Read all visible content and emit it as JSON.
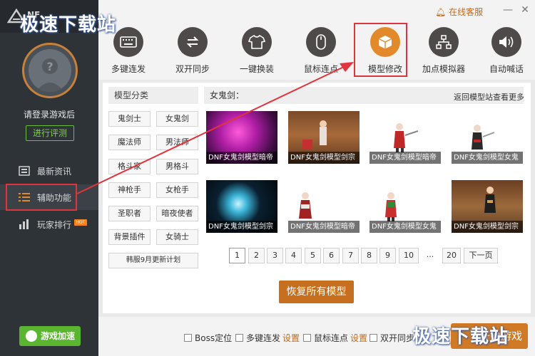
{
  "watermark_top": "极速下载站",
  "watermark_bottom": "极速下载站",
  "app": {
    "logo_text": "NF"
  },
  "topbar": {
    "service": "在线客服",
    "minimize": "—",
    "close": "✕"
  },
  "sidebar": {
    "login_text": "请登录游戏后",
    "eval_button": "进行评测",
    "nav": [
      {
        "label": "最新资讯"
      },
      {
        "label": "辅助功能"
      },
      {
        "label": "玩家排行"
      }
    ],
    "hot_badge": "HOT",
    "accel_button": "游戏加速"
  },
  "toolbar": [
    {
      "label": "多键连发",
      "icon": "keyboard-icon"
    },
    {
      "label": "双开同步",
      "icon": "sync-arrows-icon"
    },
    {
      "label": "一键换装",
      "icon": "shirt-icon"
    },
    {
      "label": "鼠标连点",
      "icon": "mouse-icon"
    },
    {
      "label": "模型修改",
      "icon": "cube-icon"
    },
    {
      "label": "加点模拟器",
      "icon": "hierarchy-icon"
    },
    {
      "label": "自动喊话",
      "icon": "speaker-icon"
    }
  ],
  "categories": {
    "title": "模型分类",
    "items": [
      "鬼剑士",
      "女鬼剑",
      "魔法师",
      "男法师",
      "格斗家",
      "男格斗",
      "神枪手",
      "女枪手",
      "圣职者",
      "暗夜使者",
      "背景插件",
      "女骑士"
    ],
    "update_plan": "韩服9月更新计划"
  },
  "models": {
    "title": "女鬼剑：",
    "link": "返回模型站查看更多",
    "items": [
      "DNF女鬼剑模型暗帝",
      "DNF女鬼剑模型剑宗",
      "DNF女鬼剑模型暗帝",
      "DNF女鬼剑模型女鬼",
      "DNF女鬼剑模型剑宗",
      "DNF女鬼剑模型暗帝",
      "DNF女鬼剑模型女鬼",
      "DNF女鬼剑模型剑宗"
    ]
  },
  "pagination": [
    "1",
    "2",
    "3",
    "4",
    "5",
    "6",
    "7",
    "8",
    "9",
    "10",
    "...",
    "20",
    "下一页"
  ],
  "restore_button": "恢复所有模型",
  "bottom": {
    "opt1": "Boss定位",
    "opt2": "多键连发",
    "opt3": "鼠标连点",
    "opt4": "双开同步",
    "settings": "设置",
    "start_button": "开始游戏"
  }
}
